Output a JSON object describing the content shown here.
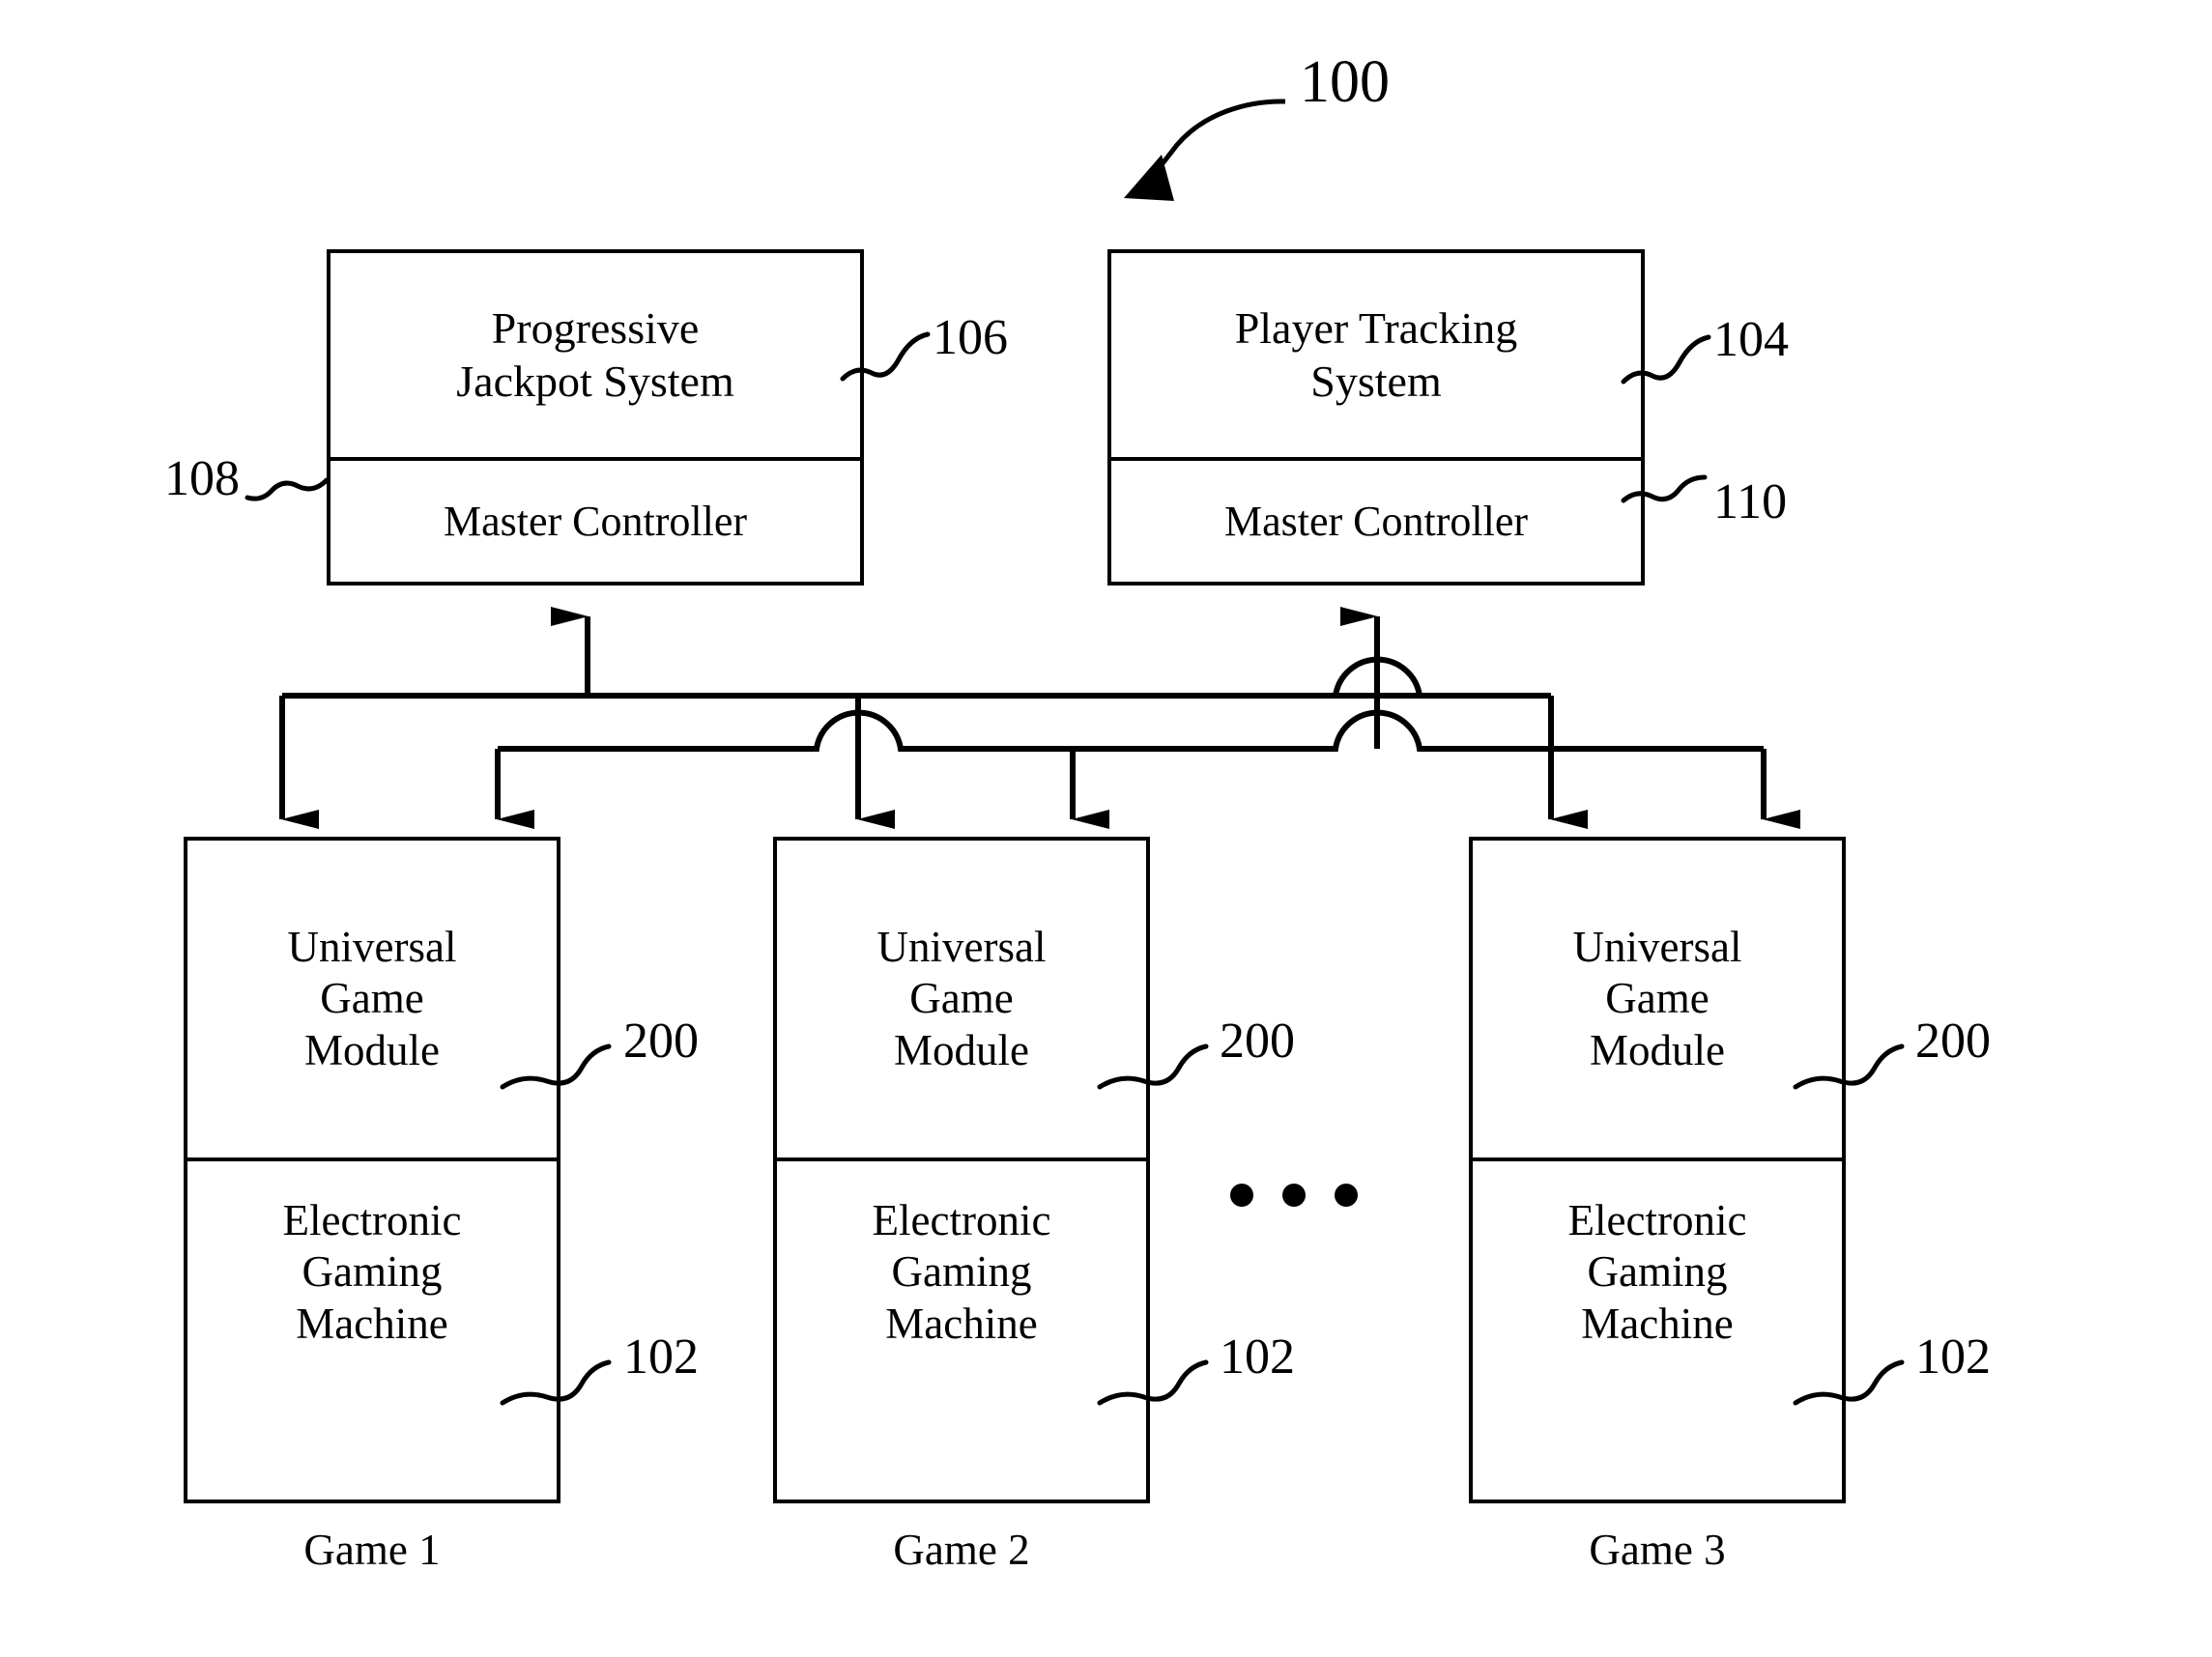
{
  "figure": {
    "number_label": "100",
    "systems": [
      {
        "id": "progressive-jackpot",
        "title": "Progressive\nJackpot System",
        "title_line1": "Progressive",
        "title_line2": "Jackpot System",
        "controller_label": "Master Controller",
        "system_ref": "106",
        "controller_ref": "108"
      },
      {
        "id": "player-tracking",
        "title": "Player Tracking\nSystem",
        "title_line1": "Player Tracking",
        "title_line2": "System",
        "controller_label": "Master Controller",
        "system_ref": "104",
        "controller_ref": "110"
      }
    ],
    "games": [
      {
        "id": "game-1",
        "caption": "Game 1",
        "module_line1": "Universal",
        "module_line2": "Game",
        "module_line3": "Module",
        "machine_line1": "Electronic",
        "machine_line2": "Gaming",
        "machine_line3": "Machine",
        "module_ref": "200",
        "machine_ref": "102"
      },
      {
        "id": "game-2",
        "caption": "Game 2",
        "module_line1": "Universal",
        "module_line2": "Game",
        "module_line3": "Module",
        "machine_line1": "Electronic",
        "machine_line2": "Gaming",
        "machine_line3": "Machine",
        "module_ref": "200",
        "machine_ref": "102"
      },
      {
        "id": "game-3",
        "caption": "Game 3",
        "module_line1": "Universal",
        "module_line2": "Game",
        "module_line3": "Module",
        "machine_line1": "Electronic",
        "machine_line2": "Gaming",
        "machine_line3": "Machine",
        "module_ref": "200",
        "machine_ref": "102"
      }
    ],
    "continuation_marker": "...",
    "colors": {
      "ink": "#000000",
      "paper": "#ffffff"
    }
  }
}
